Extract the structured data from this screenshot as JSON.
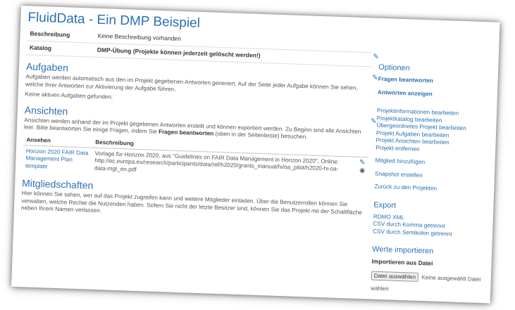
{
  "project": {
    "title": "FluidData - Ein DMP Beispiel",
    "description_label": "Beschreibung",
    "description_value": "Keine Beschreibung vorhanden",
    "catalog_label": "Katalog",
    "catalog_value": "DMP-Übung (Projekte können jederzeit gelöscht werden!)"
  },
  "tasks": {
    "heading": "Aufgaben",
    "text": "Aufgaben werden automatisch aus den im Projekt gegebenen Antworten generiert. Auf der Seite jeder Aufgabe können Sie sehen, welche Ihrer Antworten zur Aktivierung der Aufgabe führen.",
    "empty": "Keine aktiven Aufgaben gefunden."
  },
  "views": {
    "heading": "Ansichten",
    "text_before": "Ansichten werden anhand der im Projekt gegebenen Antworten erstellt und können exportiert werden. Zu Beginn sind alle Ansichten leer. Bitte beantworten Sie einige Fragen, indem Sie",
    "text_bold": "Fragen beantworten",
    "text_after": "(oben in der Seitenleiste) besuchen.",
    "col_view": "Ansehen",
    "col_desc": "Beschreibung",
    "rows": [
      {
        "name": "Horizon 2020 FAIR Data Management Plan template",
        "desc": "Vorlage für Horizon 2020, aus \"Guidelines on FAIR Data Management in Horizon 2020\", Online: http://ec.europa.eu/research/participants/data/ref/h2020/grants_manual/hi/oa_pilot/h2020-hi-oa-data-mgt_en.pdf"
      }
    ]
  },
  "members": {
    "heading": "Mitgliedschaften",
    "text": "Hier können Sie sehen, wer auf das Projekt zugreifen kann und weitere Mitglieder einladen. Über die Benutzerrollen können Sie verwalten, welche Rechte die Nutzenden haben. Sofern Sie nicht der letzte Besitzer sind, können Sie das Projekt mit der Schaltfläche neben Ihrem Namen verlassen."
  },
  "sidebar": {
    "options_heading": "Optionen",
    "answer_questions": "Fragen beantworten",
    "show_answers": "Antworten anzeigen",
    "edit_links": [
      "Projektinformationen bearbeiten",
      "Projektkatalog bearbeiten",
      "Übergeordnetes Projekt bearbeiten",
      "Projekt Aufgaben bearbeiten",
      "Projekt Ansichten bearbeiten",
      "Projekt entfernen"
    ],
    "add_member": "Mitglied hinzufügen",
    "create_snapshot": "Snapshot erstellen",
    "back_to_projects": "Zurück zu den Projekten",
    "export_heading": "Export",
    "export_links": [
      "RDMO XML",
      "CSV durch Komma getrennt",
      "CSV durch Semikolon getrennt"
    ],
    "import_heading": "Werte importieren",
    "import_label": "Importieren aus Datei",
    "file_button": "Datei auswählen",
    "file_status": "Keine ausgewählt Datei wählen"
  }
}
